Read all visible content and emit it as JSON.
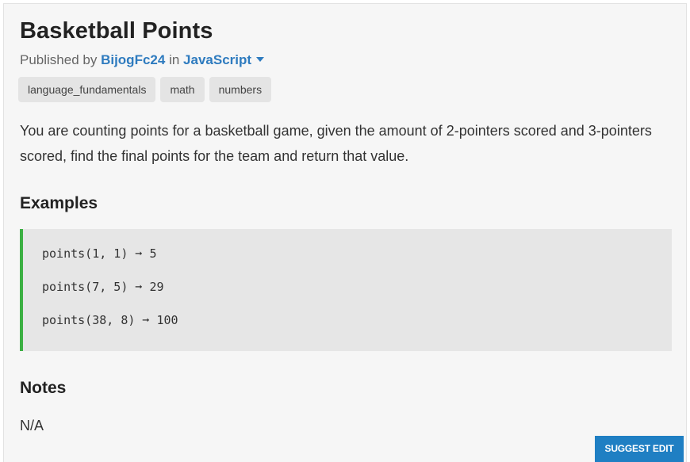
{
  "challenge": {
    "title": "Basketball Points",
    "published_by_label": "Published by",
    "author": "BijogFc24",
    "in_label": "in",
    "language": "JavaScript"
  },
  "tags": [
    "language_fundamentals",
    "math",
    "numbers"
  ],
  "description": "You are counting points for a basketball game, given the amount of 2-pointers scored and 3-pointers scored, find the final points for the team and return that value.",
  "examples": {
    "heading": "Examples",
    "lines": [
      "points(1, 1) ➞ 5",
      "points(7, 5) ➞ 29",
      "points(38, 8) ➞ 100"
    ]
  },
  "notes": {
    "heading": "Notes",
    "body": "N/A"
  },
  "suggest_edit_label": "SUGGEST EDIT",
  "colors": {
    "link": "#2e7bbf",
    "example_accent": "#3cb043",
    "suggest_button": "#1f7fc3"
  }
}
